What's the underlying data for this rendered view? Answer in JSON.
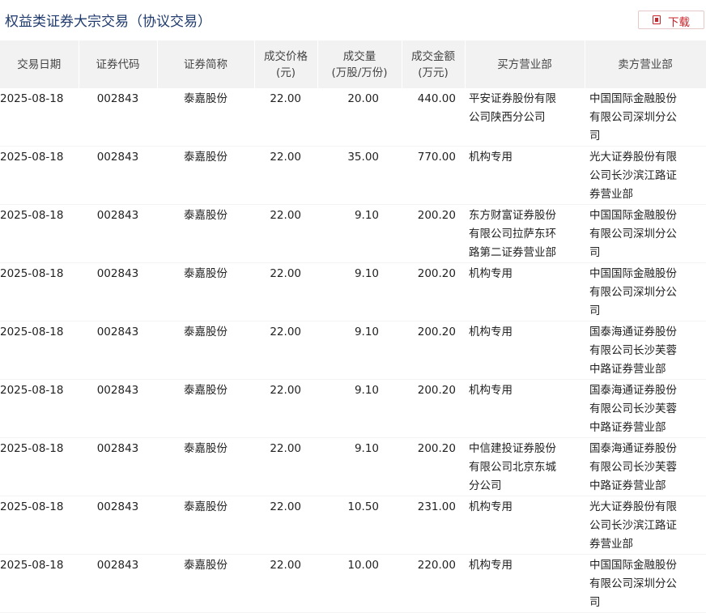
{
  "header": {
    "title": "权益类证券大宗交易（协议交易）",
    "download_label": "下载",
    "download_icon": "pdf-download-icon"
  },
  "table": {
    "columns": [
      {
        "l1": "交易日期",
        "l2": ""
      },
      {
        "l1": "证券代码",
        "l2": ""
      },
      {
        "l1": "证券简称",
        "l2": ""
      },
      {
        "l1": "成交价格",
        "l2": "(元)"
      },
      {
        "l1": "成交量",
        "l2": "(万股/万份)"
      },
      {
        "l1": "成交金额",
        "l2": "(万元)"
      },
      {
        "l1": "买方营业部",
        "l2": ""
      },
      {
        "l1": "卖方营业部",
        "l2": ""
      }
    ],
    "rows": [
      {
        "date": "2025-08-18",
        "code": "002843",
        "name": "泰嘉股份",
        "price": "22.00",
        "volume": "20.00",
        "amount": "440.00",
        "buyer": "平安证券股份有限公司陕西分公司",
        "seller": "中国国际金融股份有限公司深圳分公司"
      },
      {
        "date": "2025-08-18",
        "code": "002843",
        "name": "泰嘉股份",
        "price": "22.00",
        "volume": "35.00",
        "amount": "770.00",
        "buyer": "机构专用",
        "seller": "光大证券股份有限公司长沙滨江路证券营业部"
      },
      {
        "date": "2025-08-18",
        "code": "002843",
        "name": "泰嘉股份",
        "price": "22.00",
        "volume": "9.10",
        "amount": "200.20",
        "buyer": "东方财富证券股份有限公司拉萨东环路第二证券营业部",
        "seller": "中国国际金融股份有限公司深圳分公司"
      },
      {
        "date": "2025-08-18",
        "code": "002843",
        "name": "泰嘉股份",
        "price": "22.00",
        "volume": "9.10",
        "amount": "200.20",
        "buyer": "机构专用",
        "seller": "中国国际金融股份有限公司深圳分公司"
      },
      {
        "date": "2025-08-18",
        "code": "002843",
        "name": "泰嘉股份",
        "price": "22.00",
        "volume": "9.10",
        "amount": "200.20",
        "buyer": "机构专用",
        "seller": "国泰海通证券股份有限公司长沙芙蓉中路证券营业部"
      },
      {
        "date": "2025-08-18",
        "code": "002843",
        "name": "泰嘉股份",
        "price": "22.00",
        "volume": "9.10",
        "amount": "200.20",
        "buyer": "机构专用",
        "seller": "国泰海通证券股份有限公司长沙芙蓉中路证券营业部"
      },
      {
        "date": "2025-08-18",
        "code": "002843",
        "name": "泰嘉股份",
        "price": "22.00",
        "volume": "9.10",
        "amount": "200.20",
        "buyer": "中信建投证券股份有限公司北京东城分公司",
        "seller": "国泰海通证券股份有限公司长沙芙蓉中路证券营业部"
      },
      {
        "date": "2025-08-18",
        "code": "002843",
        "name": "泰嘉股份",
        "price": "22.00",
        "volume": "10.50",
        "amount": "231.00",
        "buyer": "机构专用",
        "seller": "光大证券股份有限公司长沙滨江路证券营业部"
      },
      {
        "date": "2025-08-18",
        "code": "002843",
        "name": "泰嘉股份",
        "price": "22.00",
        "volume": "10.00",
        "amount": "220.00",
        "buyer": "机构专用",
        "seller": "中国国际金融股份有限公司深圳分公司"
      }
    ]
  }
}
